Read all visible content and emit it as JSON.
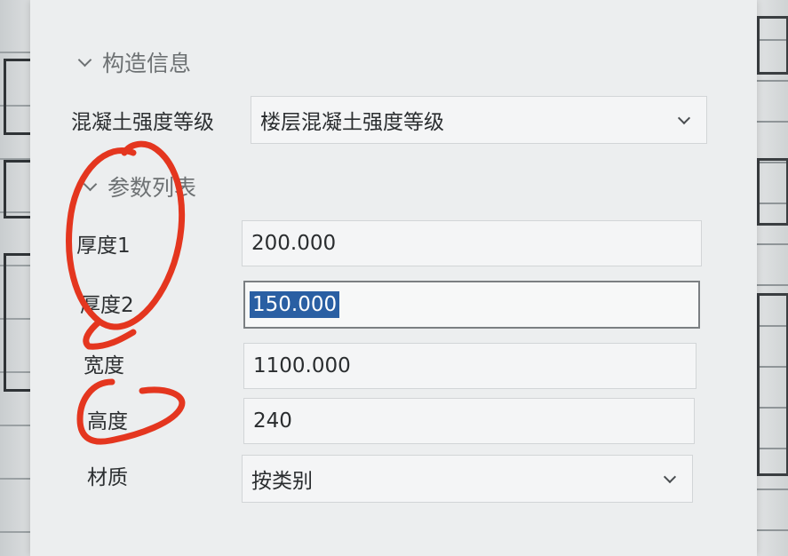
{
  "panel": {
    "construction_section": {
      "title": "构造信息"
    },
    "concrete_grade": {
      "label": "混凝土强度等级",
      "value": "楼层混凝土强度等级"
    },
    "params_section": {
      "title": "参数列表"
    },
    "params": [
      {
        "label": "厚度1",
        "value": "200.000"
      },
      {
        "label": "厚度2",
        "value": "150.000"
      },
      {
        "label": "宽度",
        "value": "1100.000"
      },
      {
        "label": "高度",
        "value": "240"
      },
      {
        "label": "材质",
        "value": "按类别"
      }
    ]
  },
  "annotation_color": "#e4361f",
  "selection_color": "#2a5fa3"
}
